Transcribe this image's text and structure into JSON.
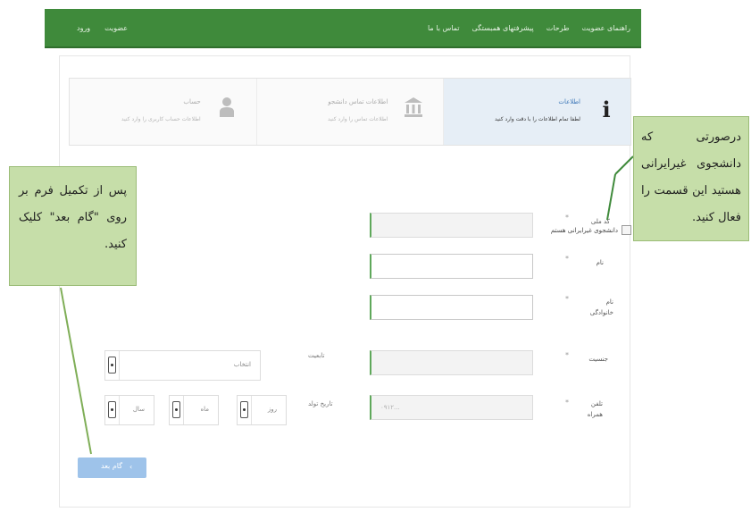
{
  "navbar": {
    "right_items": [
      "راهنمای عضویت",
      "طرحات",
      "پیشرفتهای همبستگی",
      "تماس با ما"
    ],
    "left_items": [
      "عضویت",
      "ورود"
    ]
  },
  "wizard": {
    "steps": [
      {
        "title": "اطلاعات",
        "desc": "لطفا تمام اطلاعات را با دقت وارد کنید",
        "icon": "info-icon",
        "active": true
      },
      {
        "title": "اطلاعات تماس دانشجو",
        "desc": "اطلاعات تماس را وارد کنید",
        "icon": "bank-icon",
        "active": false
      },
      {
        "title": "حساب",
        "desc": "اطلاعات حساب کاربری را وارد کنید",
        "icon": "user-icon",
        "active": false
      }
    ]
  },
  "form": {
    "foreign_checkbox_label": "دانشجوی غیرایرانی هستم",
    "national_code_label": "کد ملی",
    "first_name_label": "نام",
    "last_name_label": "نام خانوادگی",
    "gender_label": "جنسیت",
    "gender_select_value": "انتخاب",
    "nationality_label": "تابعیت",
    "birth_date_label": "تاریخ تولد",
    "day_select_value": "روز",
    "month_select_value": "ماه",
    "year_select_value": "سال",
    "mobile_label": "تلفن همراه",
    "mobile_placeholder": "۰۹۱۲...",
    "required_mark": "*"
  },
  "next_button": {
    "label": "گام بعد",
    "arrow": "‹"
  },
  "callouts": {
    "left": "پس از تکمیل فرم بر روی \"گام بعد\" کلیک کنید.",
    "right": "درصورتی که دانشجوی غیرایرانی هستید این قسمت را فعال کنید."
  },
  "colors": {
    "navbar": "#3f8a3b",
    "accent_border": "#5fa85b",
    "button": "#9ec3ea",
    "callout_bg": "#c6dea9"
  }
}
